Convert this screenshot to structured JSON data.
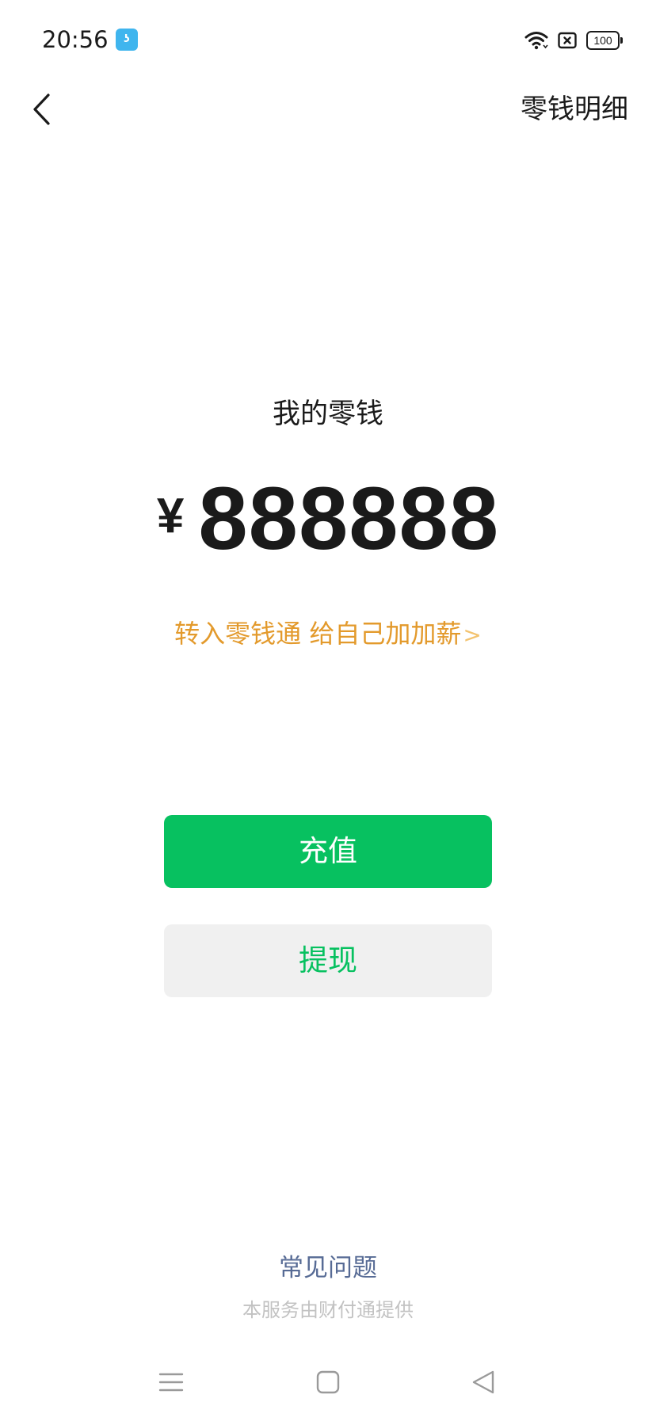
{
  "status_bar": {
    "time": "20:56",
    "app_icon_glyph": "ʖ",
    "battery_level": "100",
    "icons": [
      "wifi-icon",
      "sim-icon",
      "battery-icon"
    ]
  },
  "nav": {
    "back_icon": "chevron-left-icon",
    "detail_link": "零钱明细"
  },
  "balance": {
    "label": "我的零钱",
    "currency": "¥",
    "amount": "888888"
  },
  "promo": {
    "text": "转入零钱通 给自己加加薪",
    "arrow": ">"
  },
  "buttons": {
    "recharge": "充值",
    "withdraw": "提现"
  },
  "footer": {
    "faq": "常见问题",
    "provider": "本服务由财付通提供"
  },
  "system_nav": {
    "icons": [
      "menu-icon",
      "home-icon",
      "back-triangle-icon"
    ]
  },
  "colors": {
    "primary_green": "#07c160",
    "promo_orange": "#e39a2c",
    "link_blue": "#576b95",
    "muted_gray": "#c2c2c2",
    "button_gray": "#f0f0f0"
  }
}
